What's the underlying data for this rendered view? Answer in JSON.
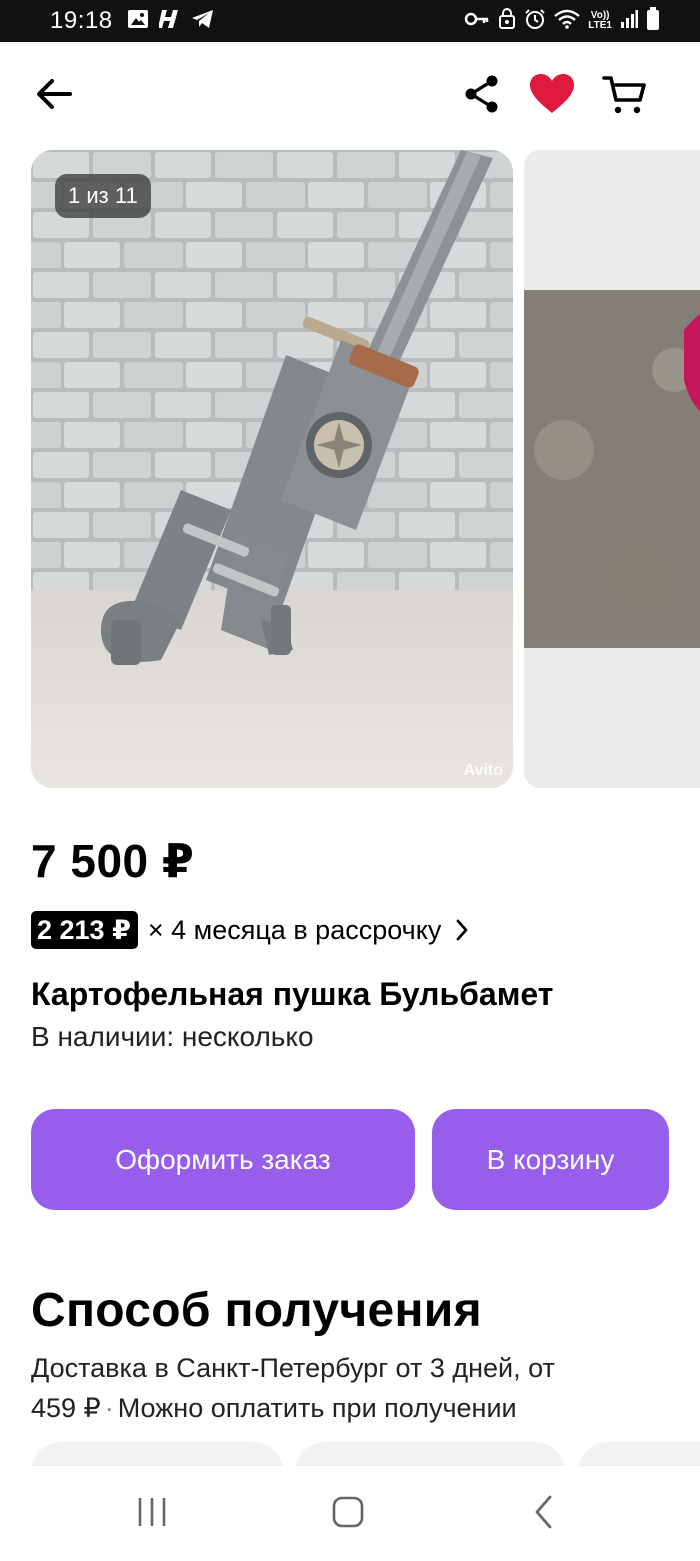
{
  "status_bar": {
    "time": "19:18",
    "icons_left": [
      "image-icon",
      "h-app-icon",
      "telegram-icon"
    ],
    "icons_right": [
      "key-icon",
      "vpn-lock-icon",
      "alarm-icon",
      "wifi-icon",
      "volte-icon",
      "signal-icon",
      "battery-icon"
    ],
    "volte_label_top": "Vo))",
    "volte_label_bottom": "LTE1"
  },
  "app_bar": {
    "back_icon": "arrow-left-icon",
    "share_icon": "share-icon",
    "favorite_icon": "heart-icon",
    "favorite_color": "#e0193e",
    "cart_icon": "cart-icon"
  },
  "gallery": {
    "counter": "1 из 11",
    "watermark": "Avito"
  },
  "product": {
    "price": "7 500 ₽",
    "installment_amount": "2 213 ₽",
    "installment_text": "× 4 месяца в рассрочку",
    "title": "Картофельная пушка Бульбамет",
    "availability": "В наличии: несколько"
  },
  "actions": {
    "order_label": "Оформить заказ",
    "cart_label": "В корзину",
    "accent_color": "#965eeb"
  },
  "delivery": {
    "section_title": "Способ получения",
    "line1": "Доставка в Санкт-Петербург от 3 дней, от",
    "price": "459 ₽",
    "separator": "·",
    "payment_note": "Можно оплатить при получении"
  },
  "nav_bar": {
    "recent_icon": "recent-apps-icon",
    "home_icon": "home-icon",
    "back_icon": "nav-back-icon"
  }
}
